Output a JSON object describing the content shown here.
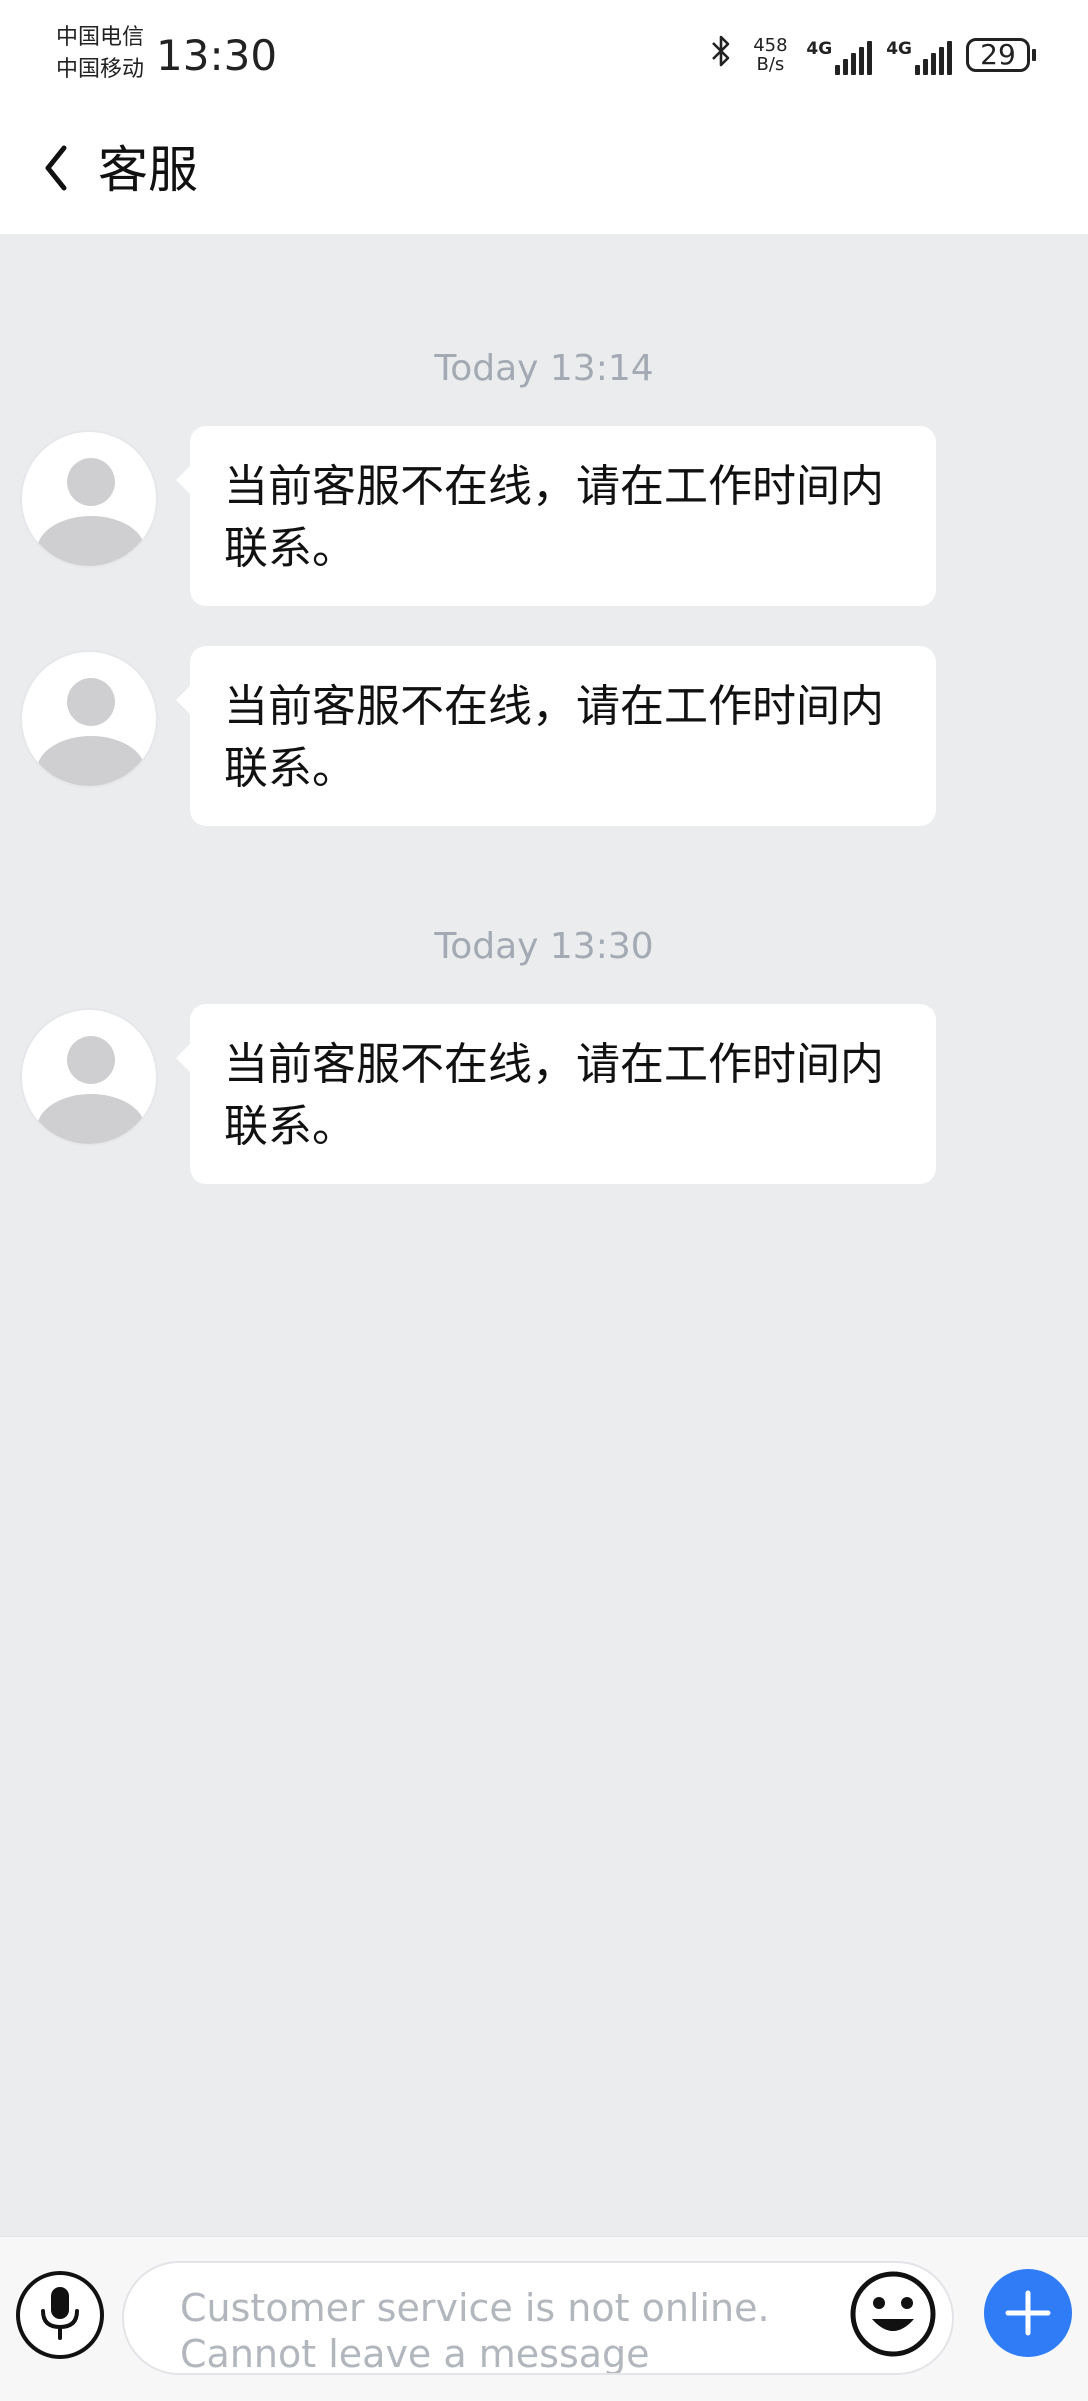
{
  "status_bar": {
    "carrier_1": "中国电信",
    "carrier_2": "中国移动",
    "time": "13:30",
    "speed_value": "458",
    "speed_unit": "B/s",
    "network_1": "4G",
    "network_2": "4G",
    "battery": "29"
  },
  "header": {
    "title": "客服",
    "back_icon": "chevron-left-icon"
  },
  "chat": {
    "groups": [
      {
        "timestamp": "Today 13:14",
        "messages": [
          "当前客服不在线，请在工作时间内联系。",
          "当前客服不在线，请在工作时间内联系。"
        ]
      },
      {
        "timestamp": "Today 13:30",
        "messages": [
          "当前客服不在线，请在工作时间内联系。"
        ]
      }
    ]
  },
  "input_bar": {
    "placeholder": "Customer service is not online. Cannot leave a message",
    "mic_icon": "microphone-icon",
    "emoji_icon": "emoji-icon",
    "add_icon": "plus-icon",
    "accent_color": "#2f7cf6"
  }
}
